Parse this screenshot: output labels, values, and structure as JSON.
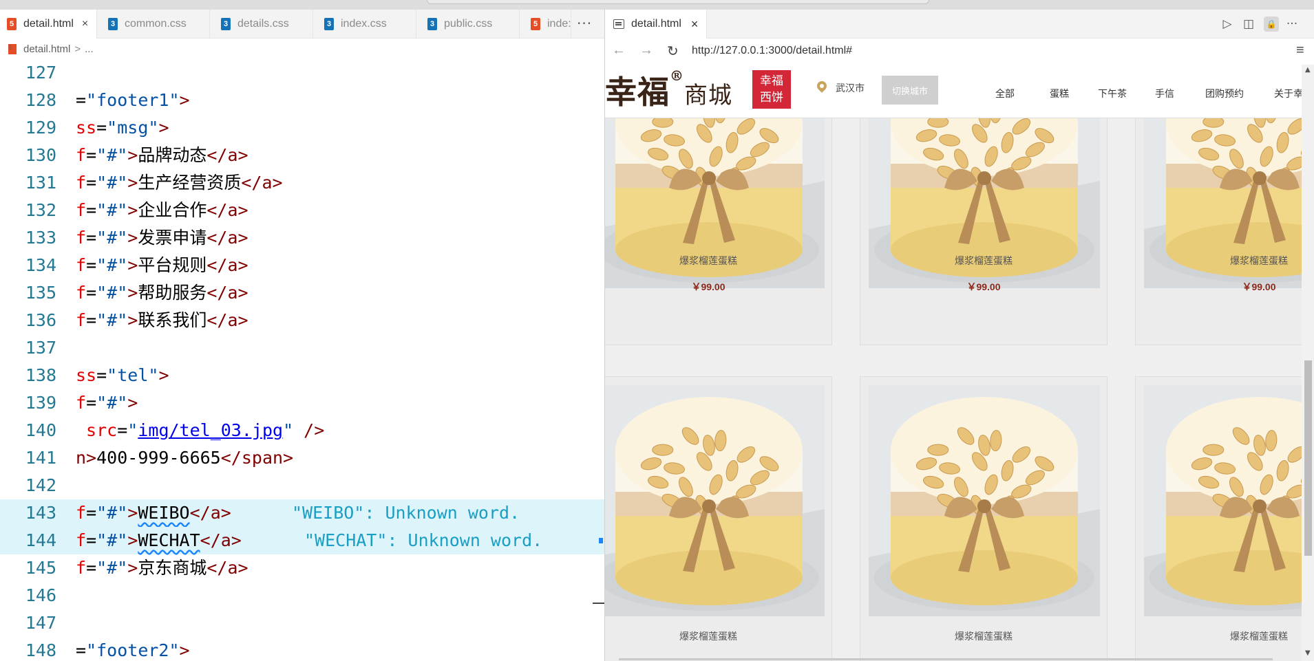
{
  "editor": {
    "tabs": [
      {
        "label": "detail.html",
        "type": "html",
        "close": "×"
      },
      {
        "label": "common.css",
        "type": "css"
      },
      {
        "label": "details.css",
        "type": "css"
      },
      {
        "label": "index.css",
        "type": "css"
      },
      {
        "label": "public.css",
        "type": "css"
      },
      {
        "label": "inde:",
        "type": "html"
      }
    ],
    "more": "···",
    "breadcrumb": {
      "file": "detail.html",
      "sep": ">",
      "rest": "..."
    },
    "lines": [
      {
        "n": "127"
      },
      {
        "n": "128",
        "a": "=",
        "s": "\"footer1\"",
        "t": ">"
      },
      {
        "n": "129",
        "attr": "ss",
        "a": "=",
        "s": "\"msg\"",
        "t": ">"
      },
      {
        "n": "130",
        "attr": "f",
        "a": "=",
        "s": "\"#\"",
        "t": ">",
        "content": "品牌动态",
        "close": "</a>"
      },
      {
        "n": "131",
        "attr": "f",
        "a": "=",
        "s": "\"#\"",
        "t": ">",
        "content": "生产经营资质",
        "close": "</a>"
      },
      {
        "n": "132",
        "attr": "f",
        "a": "=",
        "s": "\"#\"",
        "t": ">",
        "content": "企业合作",
        "close": "</a>"
      },
      {
        "n": "133",
        "attr": "f",
        "a": "=",
        "s": "\"#\"",
        "t": ">",
        "content": "发票申请",
        "close": "</a>"
      },
      {
        "n": "134",
        "attr": "f",
        "a": "=",
        "s": "\"#\"",
        "t": ">",
        "content": "平台规则",
        "close": "</a>"
      },
      {
        "n": "135",
        "attr": "f",
        "a": "=",
        "s": "\"#\"",
        "t": ">",
        "content": "帮助服务",
        "close": "</a>"
      },
      {
        "n": "136",
        "attr": "f",
        "a": "=",
        "s": "\"#\"",
        "t": ">",
        "content": "联系我们",
        "close": "</a>"
      },
      {
        "n": "137"
      },
      {
        "n": "138",
        "attr": "ss",
        "a": "=",
        "s": "\"tel\"",
        "t": ">"
      },
      {
        "n": "139",
        "attr": "f",
        "a": "=",
        "s": "\"#\"",
        "t": ">"
      },
      {
        "n": "140",
        "attr": " src",
        "a": "=",
        "q1": "\"",
        "link": "img/tel_03.jpg",
        "q2": "\"",
        "t": " />"
      },
      {
        "n": "141",
        "tagopen": "n>",
        "content": "400-999-6665",
        "close": "</span>"
      },
      {
        "n": "142"
      },
      {
        "n": "143",
        "attr": "f",
        "a": "=",
        "s": "\"#\"",
        "t": ">",
        "squig": "WEIBO",
        "close": "</a>",
        "diag": "\"WEIBO\": Unknown word."
      },
      {
        "n": "144",
        "attr": "f",
        "a": "=",
        "s": "\"#\"",
        "t": ">",
        "squig": "WECHAT",
        "close": "</a>",
        "diag": "\"WECHAT\": Unknown word."
      },
      {
        "n": "145",
        "attr": "f",
        "a": "=",
        "s": "\"#\"",
        "t": ">",
        "content": "京东商城",
        "close": "</a>"
      },
      {
        "n": "146"
      },
      {
        "n": "147"
      },
      {
        "n": "148",
        "a": "=",
        "s": "\"footer2\"",
        "t": ">"
      }
    ]
  },
  "preview": {
    "tab": {
      "label": "detail.html",
      "close": "×"
    },
    "actions": {
      "run": "▷",
      "split": "◫",
      "lock": "🔒",
      "more": "···"
    },
    "nav": {
      "back": "←",
      "forward": "→",
      "reload": "↻"
    },
    "url": "http://127.0.0.1:3000/detail.html#",
    "menu": "≡",
    "site": {
      "logo_main": "幸福",
      "logo_reg": "®",
      "logo_sub": "商城",
      "badge_line1": "幸福",
      "badge_line2": "西饼",
      "city": "武汉市",
      "switch_city": "切换城市",
      "nav": [
        "全部",
        "蛋糕",
        "下午茶",
        "手信",
        "团购预约",
        "关于幸"
      ]
    },
    "products": [
      {
        "name": "爆浆榴莲蛋糕",
        "price": "￥99.00"
      },
      {
        "name": "爆浆榴莲蛋糕",
        "price": "￥99.00"
      },
      {
        "name": "爆浆榴莲蛋糕",
        "price": "￥99.00"
      },
      {
        "name": "爆浆榴莲蛋糕"
      },
      {
        "name": "爆浆榴莲蛋糕"
      },
      {
        "name": "爆浆榴莲蛋糕"
      }
    ]
  }
}
